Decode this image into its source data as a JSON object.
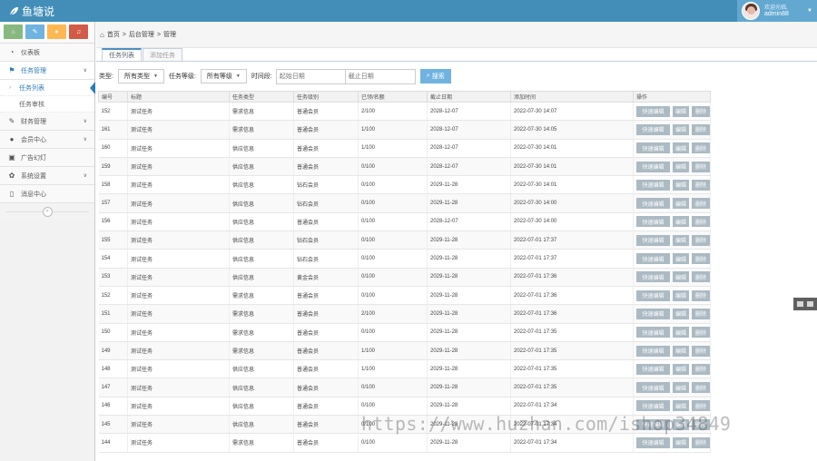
{
  "app": {
    "title": "鱼塘说"
  },
  "user": {
    "welcome": "欢迎光临,",
    "name": "admin88"
  },
  "shortcuts": [
    {
      "icon": "home-icon",
      "glyph": "⌂",
      "color": "#87b87f"
    },
    {
      "icon": "pencil-icon",
      "glyph": "✎",
      "color": "#6fb3e0"
    },
    {
      "icon": "users-icon",
      "glyph": "●",
      "color": "#ffb752"
    },
    {
      "icon": "bell-icon",
      "glyph": "♫",
      "color": "#d15b47"
    }
  ],
  "sidebar": {
    "items": [
      {
        "label": "仪表板",
        "icon": "dashboard-icon",
        "glyph": "◔"
      },
      {
        "label": "任务管理",
        "icon": "flag-icon",
        "glyph": "⚑",
        "open": true
      },
      {
        "label": "财务管理",
        "icon": "edit-icon",
        "glyph": "✎"
      },
      {
        "label": "会员中心",
        "icon": "user-icon",
        "glyph": "●"
      },
      {
        "label": "广告幻灯",
        "icon": "picture-icon",
        "glyph": "▣"
      },
      {
        "label": "系统设置",
        "icon": "gear-icon",
        "glyph": "✿"
      },
      {
        "label": "消息中心",
        "icon": "bookmark-icon",
        "glyph": "▯"
      }
    ],
    "sub_items": [
      {
        "label": "任务列表",
        "active": true
      },
      {
        "label": "任务审核"
      }
    ]
  },
  "breadcrumb": {
    "home": "首页",
    "level1": "后台管理",
    "level2": "管理",
    "sep": ">"
  },
  "tabs": [
    {
      "label": "任务列表"
    },
    {
      "label": "添加任务"
    }
  ],
  "filters": {
    "type_label": "类型:",
    "type_value": "所有类型",
    "level_label": "任务等级:",
    "level_value": "所有等级",
    "time_label": "时间段:",
    "start_placeholder": "起始日期",
    "end_placeholder": "截止日期",
    "search_label": "搜索"
  },
  "table": {
    "headers": [
      "编号",
      "标题",
      "任务类型",
      "任务级别",
      "已领/名额",
      "截止日期",
      "添加时间",
      "操作"
    ],
    "actions": [
      "快速编辑",
      "编辑",
      "删除"
    ],
    "rows": [
      [
        "152",
        "测试任务",
        "需求信息",
        "普通会员",
        "2/100",
        "2028-12-07",
        "2022-07-30 14:07"
      ],
      [
        "161",
        "测试任务",
        "需求信息",
        "普通会员",
        "1/100",
        "2028-12-07",
        "2022-07-30 14:05"
      ],
      [
        "160",
        "测试任务",
        "供应信息",
        "普通会员",
        "1/100",
        "2028-12-07",
        "2022-07-30 14:01"
      ],
      [
        "159",
        "测试任务",
        "供应信息",
        "普通会员",
        "0/100",
        "2028-12-07",
        "2022-07-30 14:01"
      ],
      [
        "158",
        "测试任务",
        "供应信息",
        "钻石会员",
        "0/100",
        "2029-11-28",
        "2022-07-30 14:01"
      ],
      [
        "157",
        "测试任务",
        "供应信息",
        "钻石会员",
        "0/100",
        "2029-11-28",
        "2022-07-30 14:00"
      ],
      [
        "156",
        "测试任务",
        "供应信息",
        "普通会员",
        "0/100",
        "2028-12-07",
        "2022-07-30 14:00"
      ],
      [
        "155",
        "测试任务",
        "供应信息",
        "钻石会员",
        "0/100",
        "2029-11-28",
        "2022-07-01 17:37"
      ],
      [
        "154",
        "测试任务",
        "供应信息",
        "钻石会员",
        "0/100",
        "2029-11-28",
        "2022-07-01 17:37"
      ],
      [
        "153",
        "测试任务",
        "供应信息",
        "黄金会员",
        "0/100",
        "2029-11-28",
        "2022-07-01 17:36"
      ],
      [
        "152",
        "测试任务",
        "需求信息",
        "普通会员",
        "0/100",
        "2029-11-28",
        "2022-07-01 17:36"
      ],
      [
        "151",
        "测试任务",
        "需求信息",
        "普通会员",
        "2/100",
        "2029-11-28",
        "2022-07-01 17:36"
      ],
      [
        "150",
        "测试任务",
        "需求信息",
        "普通会员",
        "0/100",
        "2029-11-28",
        "2022-07-01 17:35"
      ],
      [
        "149",
        "测试任务",
        "需求信息",
        "普通会员",
        "1/100",
        "2029-11-28",
        "2022-07-01 17:35"
      ],
      [
        "148",
        "测试任务",
        "供应信息",
        "普通会员",
        "1/100",
        "2029-11-28",
        "2022-07-01 17:35"
      ],
      [
        "147",
        "测试任务",
        "供应信息",
        "普通会员",
        "0/100",
        "2029-11-28",
        "2022-07-01 17:35"
      ],
      [
        "146",
        "测试任务",
        "供应信息",
        "普通会员",
        "0/100",
        "2029-11-28",
        "2022-07-01 17:34"
      ],
      [
        "145",
        "测试任务",
        "供应信息",
        "普通会员",
        "0/100",
        "2029-11-28",
        "2022-07-01 17:34"
      ],
      [
        "144",
        "测试任务",
        "需求信息",
        "普通会员",
        "0/100",
        "2029-11-28",
        "2022-07-01 17:34"
      ]
    ]
  },
  "watermark": "https://www.huzhan.com/ishop34849",
  "colors": {
    "topbar": "#438eb9",
    "accent": "#2b7dbc",
    "action_button": "#abbac3",
    "search_button": "#6fb3e0"
  }
}
